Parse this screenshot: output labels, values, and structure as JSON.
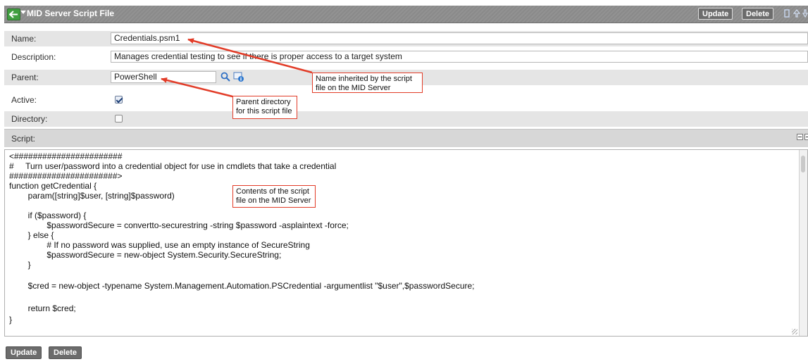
{
  "header": {
    "title": "MID Server Script File",
    "update_label": "Update",
    "delete_label": "Delete"
  },
  "form": {
    "name": {
      "label": "Name:",
      "value": "Credentials.psm1"
    },
    "description": {
      "label": "Description:",
      "value": "Manages credential testing to see if there is proper access to a target system"
    },
    "parent": {
      "label": "Parent:",
      "value": "PowerShell"
    },
    "active": {
      "label": "Active:",
      "checked": true
    },
    "directory": {
      "label": "Directory:",
      "checked": false
    }
  },
  "script": {
    "label": "Script:",
    "lines": [
      "<#######################",
      "#     Turn user/password into a credential object for use in cmdlets that take a credential",
      "#######################>",
      "function getCredential {",
      "        param([string]$user, [string]$password)",
      "",
      "        if ($password) {",
      "                $passwordSecure = convertto-securestring -string $password -asplaintext -force;",
      "        } else {",
      "                # If no password was supplied, use an empty instance of SecureString",
      "                $passwordSecure = new-object System.Security.SecureString;",
      "        }",
      "",
      "        $cred = new-object -typename System.Management.Automation.PSCredential -argumentlist \"$user\",$passwordSecure;",
      "",
      "        return $cred;",
      "}"
    ]
  },
  "footer": {
    "update_label": "Update",
    "delete_label": "Delete"
  },
  "annotations": {
    "name_note": "Name inherited by the script file on the MID Server",
    "parent_note": "Parent directory for this script file",
    "contents_note": "Contents of the script file on the MID Server"
  },
  "colors": {
    "callout_border": "#e23c28",
    "header_bar": "#8a8a8a",
    "back_button": "#3f9e3f"
  }
}
